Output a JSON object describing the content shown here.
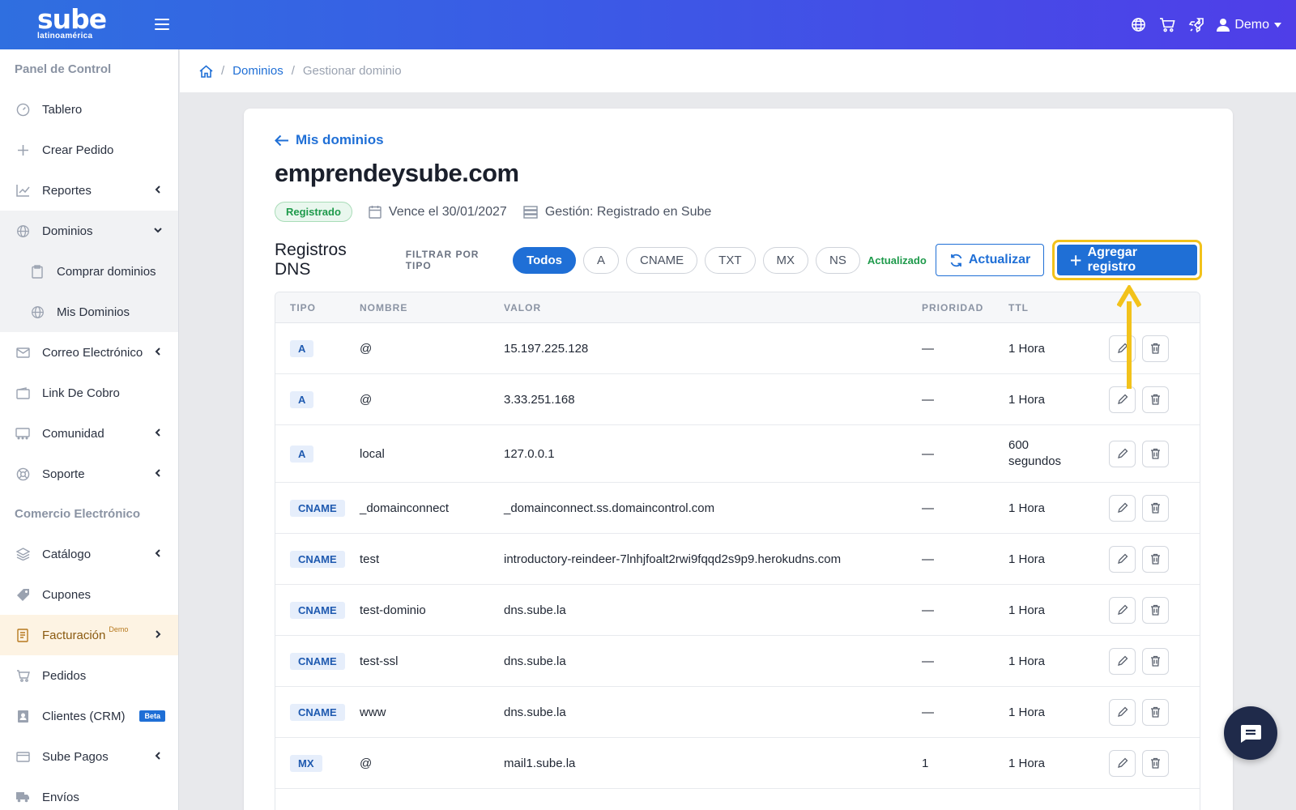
{
  "brand": {
    "logo_main": "sube",
    "logo_sub": "latinoamérica"
  },
  "topbar": {
    "user": "Demo",
    "icons": [
      "globe-icon",
      "cart-icon",
      "rocket-icon",
      "user-icon"
    ]
  },
  "sidebar": {
    "section1": "Panel de Control",
    "items": [
      {
        "label": "Tablero",
        "icon": "gauge-icon"
      },
      {
        "label": "Crear Pedido",
        "icon": "plus-icon"
      },
      {
        "label": "Reportes",
        "icon": "chart-icon"
      },
      {
        "label": "Dominios",
        "icon": "globe-icon"
      },
      {
        "label": "Comprar dominios",
        "icon": "clipboard-icon"
      },
      {
        "label": "Mis Dominios",
        "icon": "globe-icon"
      },
      {
        "label": "Correo Electrónico",
        "icon": "mail-icon"
      },
      {
        "label": "Link De Cobro",
        "icon": "wallet-icon"
      },
      {
        "label": "Comunidad",
        "icon": "community-icon"
      },
      {
        "label": "Soporte",
        "icon": "lifebuoy-icon"
      }
    ],
    "section2": "Comercio Electrónico",
    "items2": [
      {
        "label": "Catálogo",
        "icon": "layers-icon"
      },
      {
        "label": "Cupones",
        "icon": "tag-icon"
      },
      {
        "label": "Facturación",
        "icon": "invoice-icon",
        "sup": "Demo"
      },
      {
        "label": "Pedidos",
        "icon": "basket-icon"
      },
      {
        "label": "Clientes (CRM)",
        "icon": "contacts-icon",
        "badge": "Beta"
      },
      {
        "label": "Sube Pagos",
        "icon": "card-icon"
      },
      {
        "label": "Envíos",
        "icon": "truck-icon"
      }
    ]
  },
  "breadcrumb": {
    "level1": "Dominios",
    "level2": "Gestionar dominio"
  },
  "domain": {
    "back": "Mis dominios",
    "name": "emprendeysube.com",
    "status": "Registrado",
    "expires": "Vence el 30/01/2027",
    "management": "Gestión: Registrado en Sube"
  },
  "dns": {
    "title": "Registros DNS",
    "filter_label": "FILTRAR POR TIPO",
    "filters": [
      "Todos",
      "A",
      "CNAME",
      "TXT",
      "MX",
      "NS"
    ],
    "updated": "Actualizado",
    "refresh": "Actualizar",
    "add": "Agregar registro",
    "columns": [
      "TIPO",
      "NOMBRE",
      "VALOR",
      "PRIORIDAD",
      "TTL"
    ],
    "rows": [
      {
        "type": "A",
        "name": "@",
        "value": "15.197.225.128",
        "priority": "—",
        "ttl": "1 Hora"
      },
      {
        "type": "A",
        "name": "@",
        "value": "3.33.251.168",
        "priority": "—",
        "ttl": "1 Hora"
      },
      {
        "type": "A",
        "name": "local",
        "value": "127.0.0.1",
        "priority": "—",
        "ttl": "600",
        "ttl2": "segundos"
      },
      {
        "type": "CNAME",
        "name": "_domainconnect",
        "value": "_domainconnect.ss.domaincontrol.com",
        "priority": "—",
        "ttl": "1 Hora"
      },
      {
        "type": "CNAME",
        "name": "test",
        "value": "introductory-reindeer-7lnhjfoalt2rwi9fqqd2s9p9.herokudns.com",
        "priority": "—",
        "ttl": "1 Hora"
      },
      {
        "type": "CNAME",
        "name": "test-dominio",
        "value": "dns.sube.la",
        "priority": "—",
        "ttl": "1 Hora"
      },
      {
        "type": "CNAME",
        "name": "test-ssl",
        "value": "dns.sube.la",
        "priority": "—",
        "ttl": "1 Hora"
      },
      {
        "type": "CNAME",
        "name": "www",
        "value": "dns.sube.la",
        "priority": "—",
        "ttl": "1 Hora"
      },
      {
        "type": "MX",
        "name": "@",
        "value": "mail1.sube.la",
        "priority": "1",
        "ttl": "1 Hora"
      }
    ]
  },
  "colors": {
    "primary": "#1f6fd6",
    "highlight": "#f2c21b",
    "success": "#1e9a4b"
  }
}
